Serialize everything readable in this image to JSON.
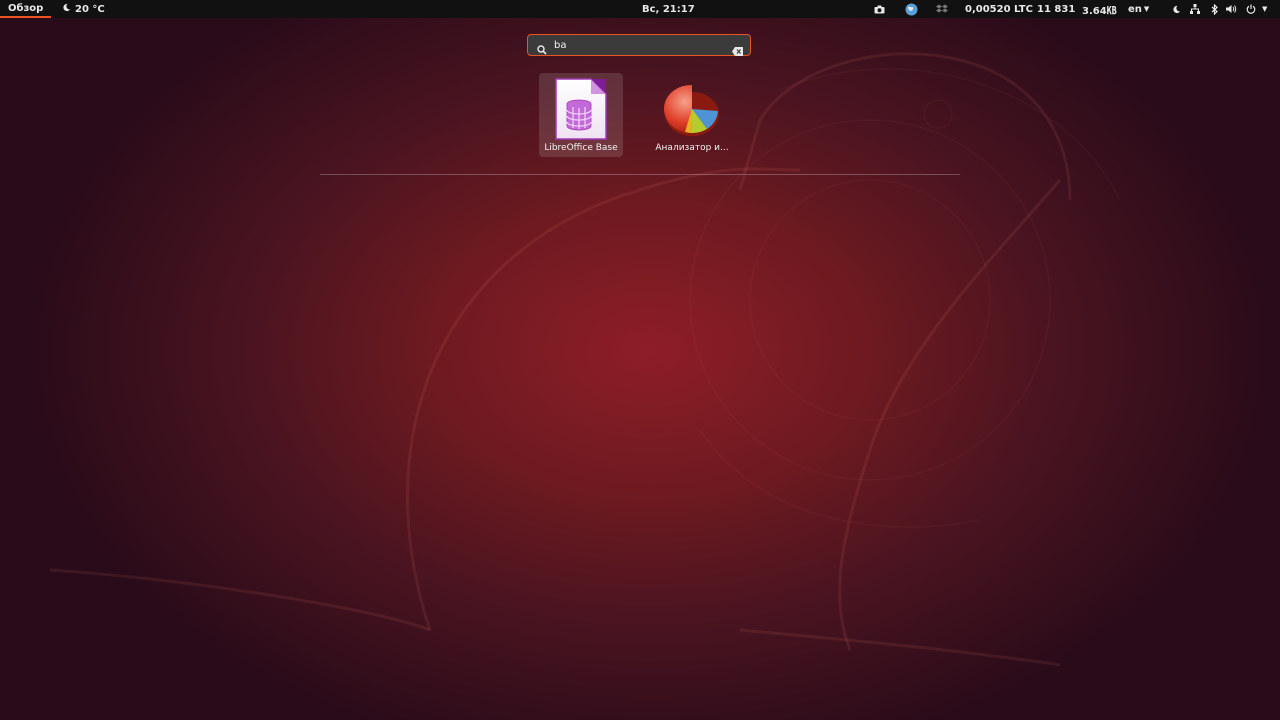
{
  "topbar": {
    "activities_label": "Обзор",
    "weather_label": "20 °C",
    "clock_label": "Вс, 21:17",
    "crypto_label": "0,00520 LTC",
    "counter_label": "11 831",
    "network_speed_label": "3.64㎅",
    "language_label": "en",
    "icons": [
      "camera-icon",
      "globe-app-icon",
      "dropbox-icon",
      "night-mode-icon",
      "network-icon",
      "bluetooth-icon",
      "volume-icon",
      "power-icon"
    ]
  },
  "search": {
    "value": "ba",
    "placeholder": ""
  },
  "results": [
    {
      "label": "LibreOffice Base",
      "icon": "libreoffice-base-icon",
      "selected": true
    },
    {
      "label": "Анализатор и...",
      "icon": "disk-usage-analyzer-icon",
      "selected": false
    }
  ],
  "colors": {
    "accent": "#e95420",
    "topbar_bg": "#111111",
    "wallpaper_center": "#8e1d28"
  }
}
